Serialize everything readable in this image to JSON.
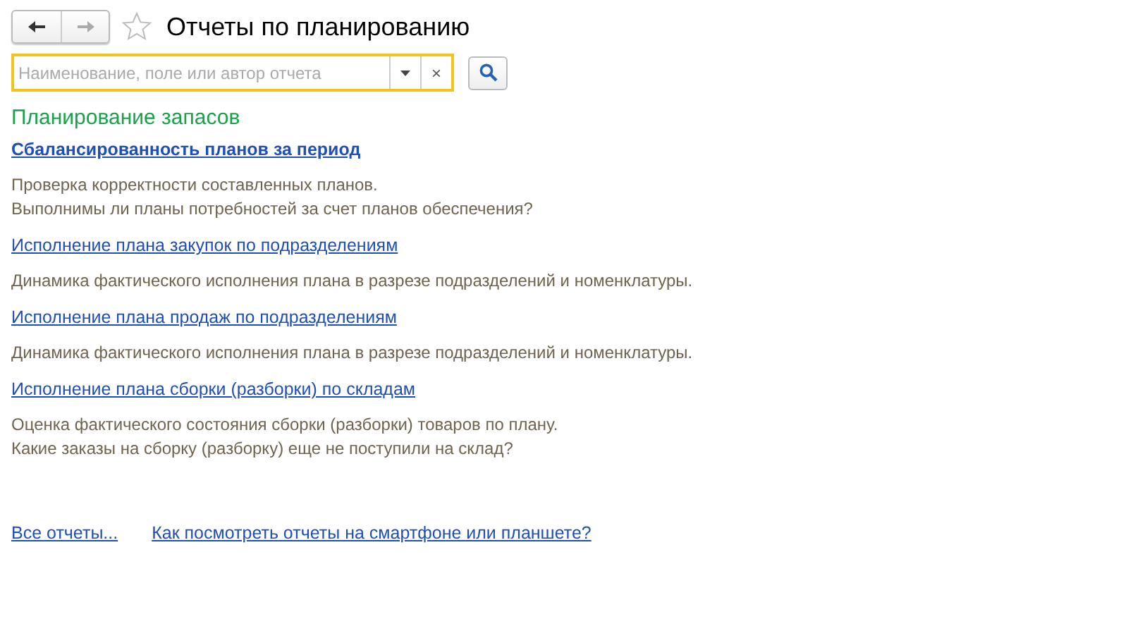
{
  "window": {
    "title": "Отчеты по планированию",
    "favorite": false
  },
  "navigation": {
    "back_disabled": false,
    "forward_disabled": true
  },
  "search": {
    "placeholder": "Наименование, поле или автор отчета",
    "focused": true,
    "clear": "×"
  },
  "section": {
    "title": "Планирование запасов"
  },
  "reports": [
    {
      "title": "Сбалансированность планов за период",
      "selected": true,
      "description": "Проверка корректности составленных планов.\nВыполнимы ли планы потребностей за счет планов обеспечения?"
    },
    {
      "title": "Исполнение плана закупок по подразделениям",
      "selected": false,
      "description": "Динамика фактического исполнения плана в разрезе подразделений и номенклатуры."
    },
    {
      "title": "Исполнение плана продаж по подразделениям",
      "selected": false,
      "description": "Динамика фактического исполнения плана в разрезе подразделений и номенклатуры."
    },
    {
      "title": "Исполнение плана сборки (разборки) по складам",
      "selected": false,
      "description": "Оценка фактического состояния сборки (разборки) товаров по плану.\nКакие заказы на сборку (разборку) еще не поступили на склад?"
    }
  ],
  "footer_links": [
    "Все отчеты...",
    "Как посмотреть отчеты на смартфоне или планшете?"
  ]
}
